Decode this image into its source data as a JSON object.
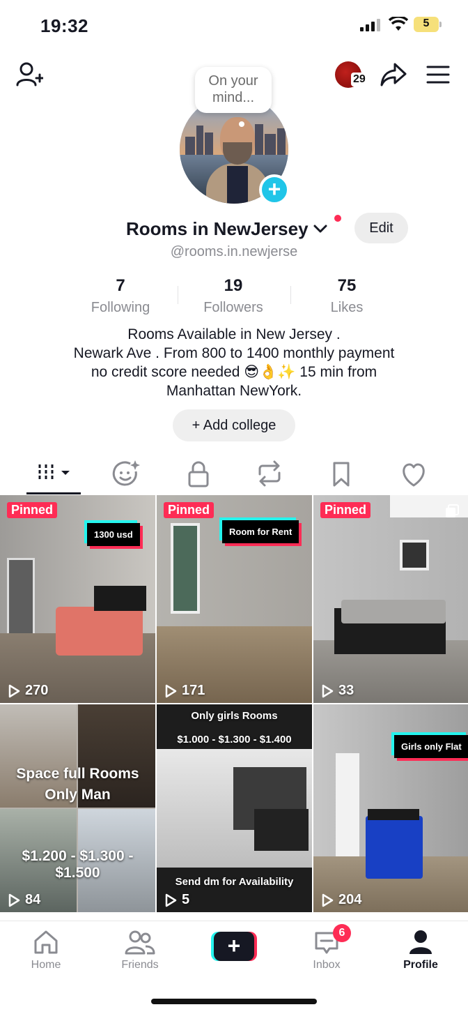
{
  "status_bar": {
    "time": "19:32",
    "battery": "5"
  },
  "header": {
    "notification_count": "29",
    "bubble_text": "On your mind..."
  },
  "profile": {
    "name": "Rooms in NewJersey",
    "username": "@rooms.in.newjerse",
    "edit_label": "Edit",
    "stats": [
      {
        "value": "7",
        "label": "Following"
      },
      {
        "value": "19",
        "label": "Followers"
      },
      {
        "value": "75",
        "label": "Likes"
      }
    ],
    "bio": "Rooms Available in New Jersey .\nNewark Ave . From 800 to 1400 monthly payment\nno credit score needed 😎👌✨ 15 min from\nManhattan NewYork.",
    "add_college_label": "+ Add college"
  },
  "tabs": [
    {
      "icon": "grid-icon",
      "active": true
    },
    {
      "icon": "sparkle-face-icon"
    },
    {
      "icon": "lock-icon"
    },
    {
      "icon": "repost-icon"
    },
    {
      "icon": "bookmark-icon"
    },
    {
      "icon": "heart-icon"
    }
  ],
  "videos": [
    {
      "pinned": "Pinned",
      "tag": "1300 usd",
      "views": "270"
    },
    {
      "pinned": "Pinned",
      "tag": "Room for Rent",
      "views": "171"
    },
    {
      "pinned": "Pinned",
      "views": "33"
    },
    {
      "caption_1": "Space full Rooms",
      "caption_2": "Only Man",
      "caption_3": "$1.200 - $1.300 - $1.500",
      "views": "84"
    },
    {
      "caption_1": "Only girls Rooms",
      "caption_2": "$1.000 - $1.300 - $1.400",
      "caption_3": "Send dm for Availability",
      "views": "5"
    },
    {
      "tag": "Girls only Flat",
      "views": "204"
    }
  ],
  "bottom_nav": {
    "home": "Home",
    "friends": "Friends",
    "inbox": "Inbox",
    "inbox_badge": "6",
    "profile": "Profile"
  },
  "colors": {
    "accent": "#fe2c55",
    "cyan": "#25f4ee",
    "add_avatar": "#20c5e8"
  }
}
